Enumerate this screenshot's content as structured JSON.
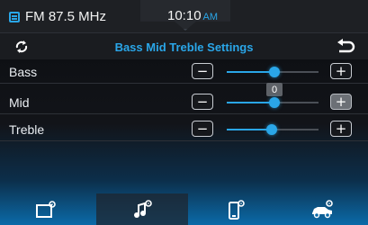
{
  "status_bar": {
    "radio": "FM 87.5 MHz",
    "time": "10:10",
    "ampm": "AM"
  },
  "header": {
    "title": "Bass Mid Treble Settings"
  },
  "controls": [
    {
      "label": "Bass",
      "value": 0,
      "level": 0.5
    },
    {
      "label": "Mid",
      "value": 0,
      "level": 0.5
    },
    {
      "label": "Treble",
      "value": 0,
      "level": 0.45
    }
  ],
  "buttons": {
    "minus": "−",
    "plus": "+"
  },
  "tooltip": {
    "value": "0"
  },
  "bottom_tabs": [
    {
      "icon": "display-settings-icon",
      "selected": false
    },
    {
      "icon": "sound-settings-icon",
      "selected": true
    },
    {
      "icon": "phone-settings-icon",
      "selected": false
    },
    {
      "icon": "vehicle-settings-icon",
      "selected": false
    }
  ],
  "colors": {
    "accent": "#2aa6e8",
    "background": "#121419"
  }
}
